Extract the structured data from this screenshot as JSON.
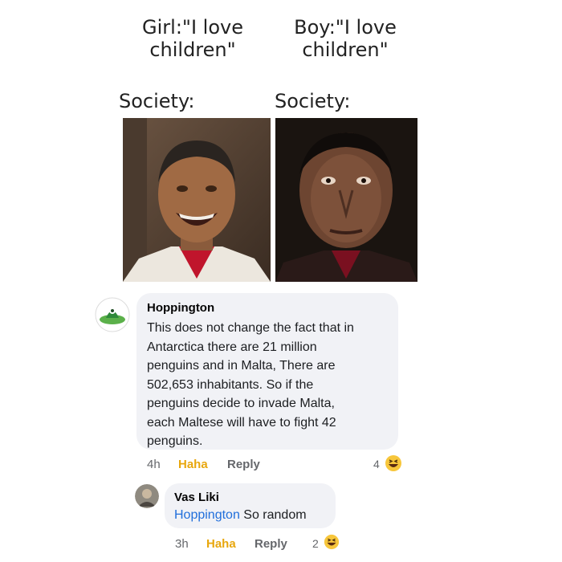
{
  "meme": {
    "left_caption": [
      "Girl:\"I love",
      "children\""
    ],
    "right_caption": [
      "Boy:\"I love",
      "children\""
    ],
    "society_left": "Society:",
    "society_right": "Society:",
    "left_photo_icon": "laughing-man-photo",
    "right_photo_icon": "serious-man-photo"
  },
  "comments": [
    {
      "author": "Hoppington",
      "text_lines": [
        "This does not change the fact that in",
        "Antarctica there are 21 million",
        "penguins and in Malta, There are",
        "502,653 inhabitants. So if the",
        "penguins decide to invade Malta,",
        "each Maltese will have to fight 42",
        "penguins."
      ],
      "time": "4h",
      "reaction_label": "Haha",
      "reply_label": "Reply",
      "reaction_count": "4",
      "avatar_icon": "green-penguin-logo-avatar"
    },
    {
      "author": "Vas Liki",
      "mention": "Hoppington",
      "text": " So random",
      "time": "3h",
      "reaction_label": "Haha",
      "reply_label": "Reply",
      "reaction_count": "2",
      "avatar_icon": "user-photo-avatar"
    }
  ],
  "colors": {
    "bubble": "#f1f2f6",
    "haha": "#e8a70e",
    "link": "#216fdb",
    "muted": "#65676b"
  }
}
